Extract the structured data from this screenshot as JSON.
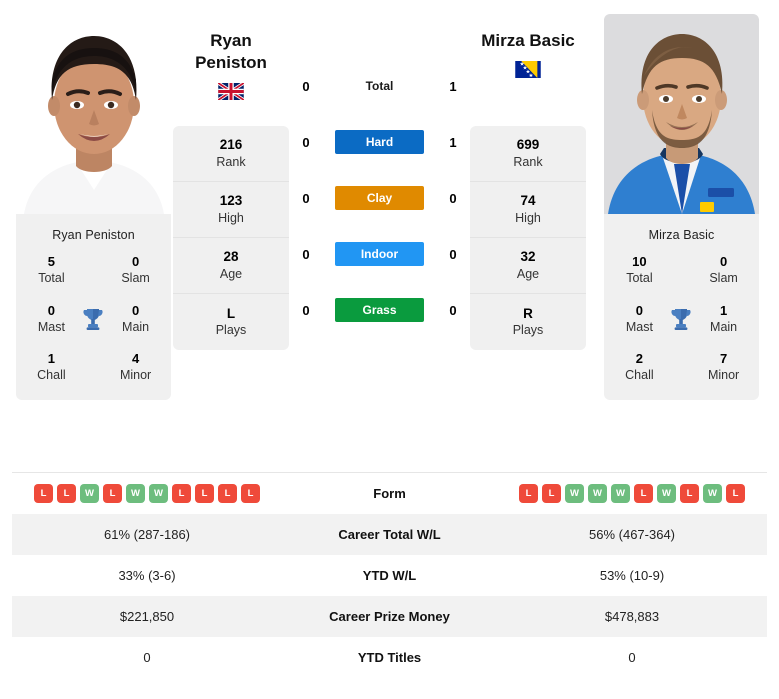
{
  "players": {
    "left": {
      "name": "Ryan Peniston",
      "name_line1": "Ryan",
      "name_line2": "Peniston",
      "photo_name": "Ryan Peniston",
      "flag": "gb-flag",
      "stats": [
        {
          "value": "216",
          "label": "Rank"
        },
        {
          "value": "123",
          "label": "High"
        },
        {
          "value": "28",
          "label": "Age"
        },
        {
          "value": "L",
          "label": "Plays"
        }
      ],
      "titles": {
        "total": "5",
        "slam": "0",
        "mast": "0",
        "main": "0",
        "chall": "1",
        "minor": "4"
      },
      "form": [
        "L",
        "L",
        "W",
        "L",
        "W",
        "W",
        "L",
        "L",
        "L",
        "L"
      ],
      "career_wl": "61% (287-186)",
      "ytd_wl": "33% (3-6)",
      "prize": "$221,850",
      "ytd_titles": "0"
    },
    "right": {
      "name": "Mirza Basic",
      "name_line1": "Mirza Basic",
      "name_line2": "",
      "photo_name": "Mirza Basic",
      "flag": "ba-flag",
      "stats": [
        {
          "value": "699",
          "label": "Rank"
        },
        {
          "value": "74",
          "label": "High"
        },
        {
          "value": "32",
          "label": "Age"
        },
        {
          "value": "R",
          "label": "Plays"
        }
      ],
      "titles": {
        "total": "10",
        "slam": "0",
        "mast": "0",
        "main": "1",
        "chall": "2",
        "minor": "7"
      },
      "form": [
        "L",
        "L",
        "W",
        "W",
        "W",
        "L",
        "W",
        "L",
        "W",
        "L"
      ],
      "career_wl": "56% (467-364)",
      "ytd_wl": "53% (10-9)",
      "prize": "$478,883",
      "ytd_titles": "0"
    }
  },
  "titles_labels": {
    "total": "Total",
    "slam": "Slam",
    "mast": "Mast",
    "main": "Main",
    "chall": "Chall",
    "minor": "Minor",
    "trophy_icon": "trophy-icon"
  },
  "h2h": {
    "rows": [
      {
        "key": "total",
        "label": "Total",
        "left": "0",
        "right": "1",
        "color": "",
        "is_total": true
      },
      {
        "key": "hard",
        "label": "Hard",
        "left": "0",
        "right": "1",
        "color": "#0b6bc4",
        "is_total": false
      },
      {
        "key": "clay",
        "label": "Clay",
        "left": "0",
        "right": "0",
        "color": "#e08a00",
        "is_total": false
      },
      {
        "key": "indoor",
        "label": "Indoor",
        "left": "0",
        "right": "0",
        "color": "#2196f3",
        "is_total": false
      },
      {
        "key": "grass",
        "label": "Grass",
        "left": "0",
        "right": "0",
        "color": "#0a9b3e",
        "is_total": false
      }
    ]
  },
  "table": {
    "rows": [
      {
        "key": "form",
        "label": "Form",
        "type": "form",
        "shaded": false
      },
      {
        "key": "career_wl",
        "label": "Career Total W/L",
        "type": "text",
        "shaded": true,
        "left": "61% (287-186)",
        "right": "56% (467-364)"
      },
      {
        "key": "ytd_wl",
        "label": "YTD W/L",
        "type": "text",
        "shaded": false,
        "left": "33% (3-6)",
        "right": "53% (10-9)"
      },
      {
        "key": "prize",
        "label": "Career Prize Money",
        "type": "text",
        "shaded": true,
        "left": "$221,850",
        "right": "$478,883"
      },
      {
        "key": "ytd_titles",
        "label": "YTD Titles",
        "type": "text",
        "shaded": false,
        "left": "0",
        "right": "0"
      }
    ]
  },
  "colors": {
    "hard": "#0b6bc4",
    "clay": "#e08a00",
    "indoor": "#2196f3",
    "grass": "#0a9b3e",
    "win": "#6dbd7e",
    "loss": "#ef4a3a",
    "panel": "#f0f0f0",
    "row_shade": "#f2f2f2"
  }
}
